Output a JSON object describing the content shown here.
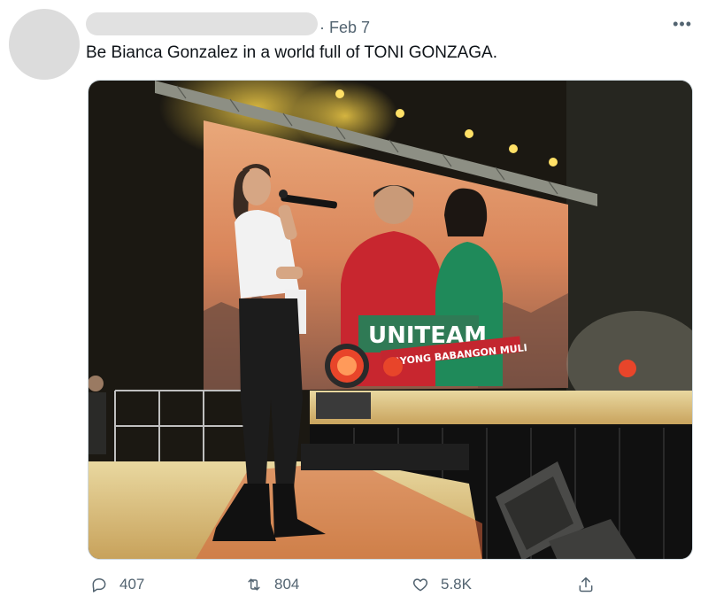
{
  "tweet": {
    "date": "· Feb 7",
    "more": "•••",
    "text": "Be Bianca Gonzalez in a world full of TONI GONZAGA."
  },
  "media": {
    "banner_title": "UNITEAM",
    "banner_sub": "AYONG BABANGON MULI"
  },
  "actions": {
    "replies": "407",
    "retweets": "804",
    "likes": "5.8K"
  },
  "icons": [
    "reply-icon",
    "retweet-icon",
    "like-icon",
    "share-icon",
    "more-icon"
  ]
}
